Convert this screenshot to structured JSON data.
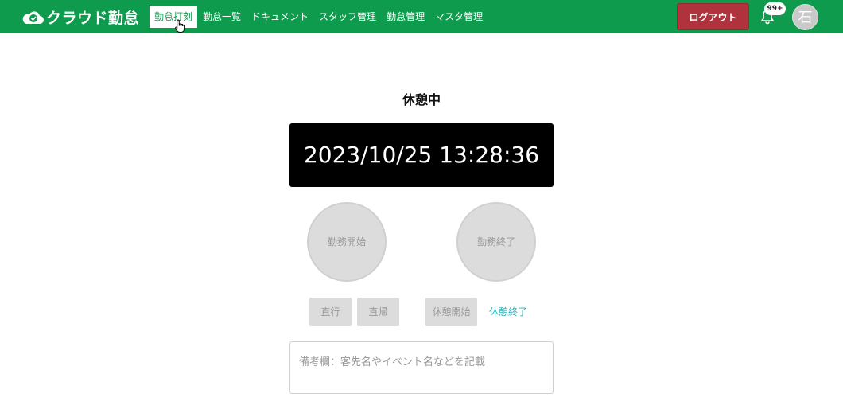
{
  "header": {
    "logo_text": "クラウド勤怠",
    "nav": [
      {
        "label": "勤怠打刻",
        "active": true
      },
      {
        "label": "勤怠一覧",
        "active": false
      },
      {
        "label": "ドキュメント",
        "active": false
      },
      {
        "label": "スタッフ管理",
        "active": false
      },
      {
        "label": "勤怠管理",
        "active": false
      },
      {
        "label": "マスタ管理",
        "active": false
      }
    ],
    "logout_label": "ログアウト",
    "notification_badge": "99+",
    "avatar_initial": "石",
    "colors": {
      "brand": "#0f9b4e",
      "logout": "#b0323c"
    }
  },
  "main": {
    "status": "休憩中",
    "clock": "2023/10/25 13:28:36",
    "work_start_label": "勤務開始",
    "work_end_label": "勤務終了",
    "direct_go_label": "直行",
    "direct_return_label": "直帰",
    "break_start_label": "休憩開始",
    "break_end_label": "休憩終了",
    "remarks_placeholder": "備考欄：客先名やイベント名などを記載",
    "colors": {
      "link": "#2ab0b8",
      "disabled": "#dcdcdc"
    }
  }
}
